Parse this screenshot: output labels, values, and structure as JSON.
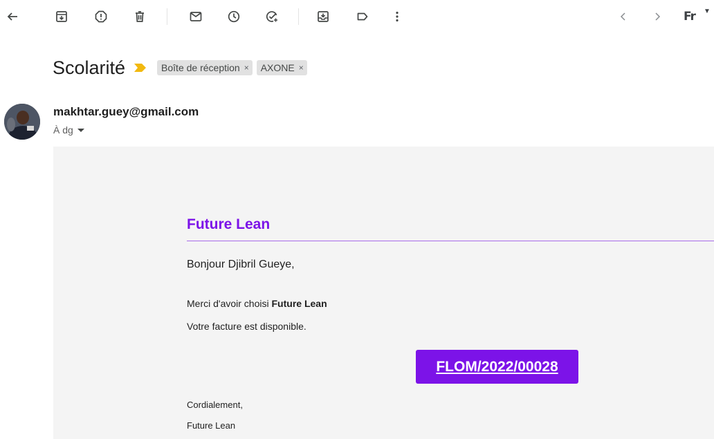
{
  "toolbar": {
    "back": "back-arrow-icon",
    "archive": "archive-icon",
    "report_spam": "report-spam-icon",
    "delete": "trash-icon",
    "mark_unread": "mail-icon",
    "snooze": "clock-icon",
    "add_task": "add-task-icon",
    "move_to": "move-to-icon",
    "labels": "label-icon",
    "more": "more-vert-icon",
    "prev": "chevron-left-icon",
    "next": "chevron-right-icon",
    "input_tools_label": "Fr"
  },
  "message": {
    "subject": "Scolarité",
    "labels": [
      {
        "label": "Boîte de réception",
        "remove": "×"
      },
      {
        "label": "AXONE",
        "remove": "×"
      }
    ],
    "sender": "makhtar.guey@gmail.com",
    "recipient": "À dg"
  },
  "email_body": {
    "brand": "Future Lean",
    "greeting": "Bonjour Djibril Gueye,",
    "thanks_prefix": "Merci d'avoir choisi ",
    "thanks_brand": "Future Lean",
    "invoice_text": "Votre facture est disponible.",
    "invoice_link": "FLOM/2022/00028",
    "closing": "Cordialement,",
    "signature": "Future Lean"
  },
  "colors": {
    "brand_purple": "#7c13e8",
    "importance_yellow": "#f2b90f",
    "chip_bg": "#e1e1e1",
    "body_bg": "#f4f4f4"
  }
}
